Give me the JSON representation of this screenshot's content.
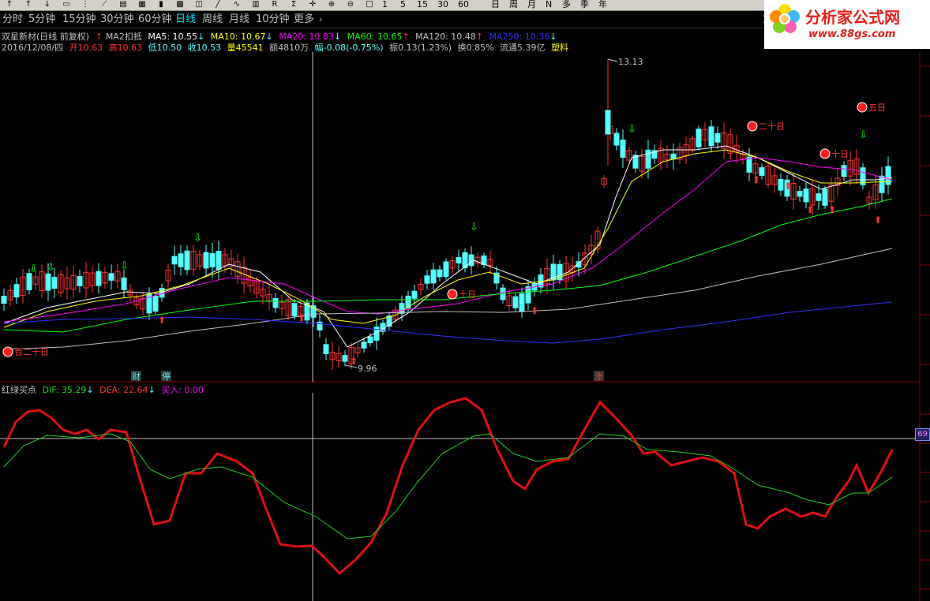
{
  "toolbar": {
    "items": [
      "1",
      "5",
      "15",
      "30",
      "60"
    ],
    "periods_right": [
      "日",
      "周",
      "月",
      "N",
      "多",
      "季",
      "年"
    ]
  },
  "period_tabs": [
    "分时",
    "5分钟",
    "15分钟",
    "30分钟",
    "60分钟",
    "日线",
    "周线",
    "月线",
    "10分钟",
    "更多"
  ],
  "active_period": "日线",
  "logo": {
    "title": "分析家公式网",
    "url": "www.88gs.com",
    "side_label": "复"
  },
  "header": {
    "stock": "双星新材(日线 前复权)",
    "indicator": "MA2扣抵",
    "ma": [
      {
        "label": "MA5: 10.55",
        "arrow": "↓",
        "color": "#ffffff"
      },
      {
        "label": "MA10: 10.67",
        "arrow": "↓",
        "color": "#ffff00"
      },
      {
        "label": "MA20: 10.83",
        "arrow": "↓",
        "color": "#ff00ff"
      },
      {
        "label": "MA60: 10.65",
        "arrow": "↑",
        "color": "#00ff00"
      },
      {
        "label": "MA120: 10.48",
        "arrow": "↑",
        "color": "#c0c0c0"
      },
      {
        "label": "MA250: 10.36",
        "arrow": "↓",
        "color": "#3030ff"
      }
    ],
    "date": "2016/12/08/四",
    "open": "开10.63",
    "high": "高10.63",
    "low": "低10.50",
    "close": "收10.53",
    "volume": "量45541",
    "amount": "额4810万",
    "change": "幅-0.08(-0.75%)",
    "amplitude": "振0.13(1.23%)",
    "turnover": "换0.85%",
    "float": "流通5.39亿",
    "sector": "塑料"
  },
  "price_labels": {
    "high": "13.13",
    "low": "9.96"
  },
  "markers": {
    "ten_day": "十日",
    "twenty_day": "二十日",
    "five_day": "五日",
    "hundred_twenty": "百二十日",
    "finance": "财",
    "halt": "停",
    "rise": "涨"
  },
  "indicator_panel": {
    "name": "红绿买点",
    "dif": "DIF: 35.29",
    "dif_arrow": "↓",
    "dea": "DEA: 22.64",
    "dea_arrow": "↓",
    "buy": "买入: 0.00",
    "right_value": "69"
  },
  "colors": {
    "up": "#ff3232",
    "down": "#54ffff",
    "ma5": "#ffffff",
    "ma10": "#ffff00",
    "ma20": "#ff00ff",
    "ma60": "#00ff00",
    "ma120": "#c0c0c0",
    "ma250": "#3030ff",
    "dif": "#e01010",
    "dea": "#20d020",
    "grid": "#8b0000"
  }
}
